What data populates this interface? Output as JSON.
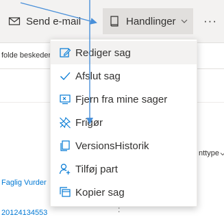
{
  "toolbar": {
    "send_label": "Send e-mail",
    "actions_label": "Handlinger",
    "more_label": "···"
  },
  "subtitle": "folde beskeder",
  "menu": {
    "items": [
      {
        "label": "Rediger sag",
        "icon": "edit-icon"
      },
      {
        "label": "Afslut sag",
        "icon": "checkmark-icon"
      },
      {
        "label": "Fjern fra mine sager",
        "icon": "remove-icon"
      },
      {
        "label": "Frigør",
        "icon": "unpin-icon"
      },
      {
        "label": "VersionsHistorik",
        "icon": "copy-icon"
      },
      {
        "label": "Tilføj part",
        "icon": "add-person-icon"
      },
      {
        "label": "Kopier sag",
        "icon": "copy-case-icon"
      }
    ]
  },
  "table": {
    "column_type": "nttype",
    "cell_a": "Faglig Vurder",
    "cell_b": "20124134553",
    "cell_dots": ":"
  },
  "colors": {
    "accent": "#0078d4",
    "arrow": "#4a90d9",
    "toolbar_bg": "#f3f2f1",
    "selected_bg": "#f3f2f1"
  }
}
